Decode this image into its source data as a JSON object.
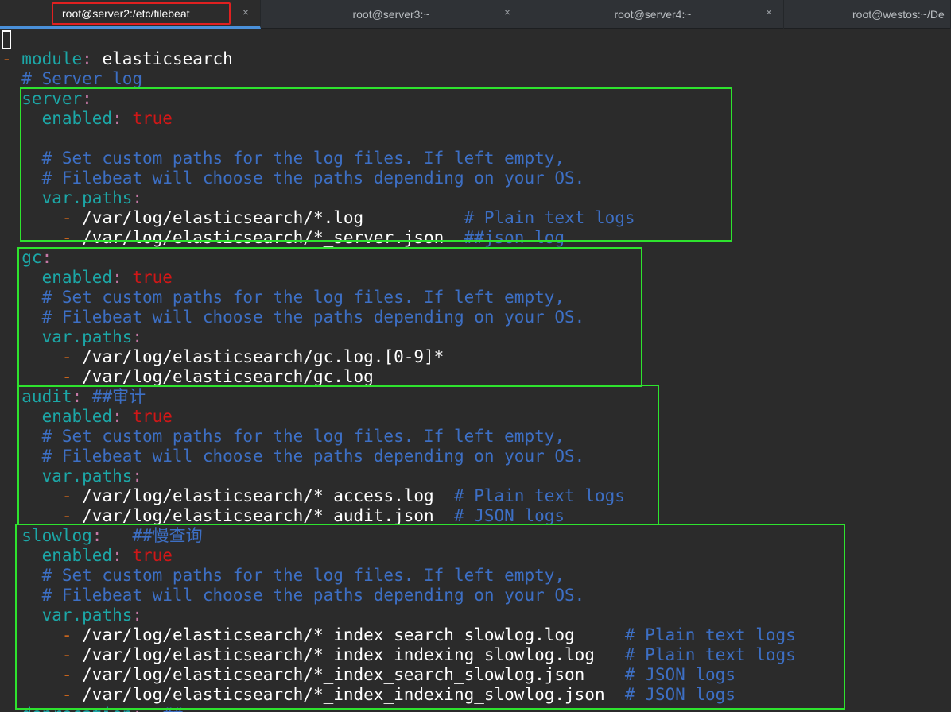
{
  "tabs": [
    {
      "title": "root@server2:/etc/filebeat",
      "active": true
    },
    {
      "title": "root@server3:~",
      "active": false
    },
    {
      "title": "root@server4:~",
      "active": false
    },
    {
      "title": "root@westos:~/De",
      "active": false
    }
  ],
  "close_glyph": "×",
  "colors": {
    "key": "#1ca7a7",
    "comment": "#3d6fc4",
    "bool": "#d11717",
    "dash": "#c7641c",
    "highlight_box": "#2ee32e",
    "tab_highlight": "#e02020"
  },
  "terminal": {
    "lines": [
      [],
      [
        [
          "dash",
          "- "
        ],
        [
          "key",
          "module"
        ],
        [
          "colon",
          ": "
        ],
        [
          "val",
          "elasticsearch"
        ]
      ],
      [
        [
          "comment",
          "  # Server log"
        ]
      ],
      [
        [
          "key",
          "  server"
        ],
        [
          "colon",
          ":"
        ]
      ],
      [
        [
          "key",
          "    enabled"
        ],
        [
          "colon",
          ": "
        ],
        [
          "boolval",
          "true"
        ]
      ],
      [],
      [
        [
          "comment",
          "    # Set custom paths for the log files. If left empty,"
        ]
      ],
      [
        [
          "comment",
          "    # Filebeat will choose the paths depending on your OS."
        ]
      ],
      [
        [
          "key",
          "    var.paths"
        ],
        [
          "colon",
          ":"
        ]
      ],
      [
        [
          "dash",
          "      - "
        ],
        [
          "val",
          "/var/log/elasticsearch/*.log          "
        ],
        [
          "comment",
          "# Plain text logs"
        ]
      ],
      [
        [
          "dash",
          "      - "
        ],
        [
          "val",
          "/var/log/elasticsearch/*_server.json  "
        ],
        [
          "comment",
          "##json log"
        ]
      ],
      [
        [
          "key",
          "  gc"
        ],
        [
          "colon",
          ":"
        ]
      ],
      [
        [
          "key",
          "    enabled"
        ],
        [
          "colon",
          ": "
        ],
        [
          "boolval",
          "true"
        ]
      ],
      [
        [
          "comment",
          "    # Set custom paths for the log files. If left empty,"
        ]
      ],
      [
        [
          "comment",
          "    # Filebeat will choose the paths depending on your OS."
        ]
      ],
      [
        [
          "key",
          "    var.paths"
        ],
        [
          "colon",
          ":"
        ]
      ],
      [
        [
          "dash",
          "      - "
        ],
        [
          "val",
          "/var/log/elasticsearch/gc.log.[0-9]*"
        ]
      ],
      [
        [
          "dash",
          "      - "
        ],
        [
          "val",
          "/var/log/elasticsearch/gc.log"
        ]
      ],
      [
        [
          "key",
          "  audit"
        ],
        [
          "colon",
          ": "
        ],
        [
          "comment",
          "##审计"
        ]
      ],
      [
        [
          "key",
          "    enabled"
        ],
        [
          "colon",
          ": "
        ],
        [
          "boolval",
          "true"
        ]
      ],
      [
        [
          "comment",
          "    # Set custom paths for the log files. If left empty,"
        ]
      ],
      [
        [
          "comment",
          "    # Filebeat will choose the paths depending on your OS."
        ]
      ],
      [
        [
          "key",
          "    var.paths"
        ],
        [
          "colon",
          ":"
        ]
      ],
      [
        [
          "dash",
          "      - "
        ],
        [
          "val",
          "/var/log/elasticsearch/*_access.log  "
        ],
        [
          "comment",
          "# Plain text logs"
        ]
      ],
      [
        [
          "dash",
          "      - "
        ],
        [
          "val",
          "/var/log/elasticsearch/*_audit.json  "
        ],
        [
          "comment",
          "# JSON logs"
        ]
      ],
      [
        [
          "key",
          "  slowlog"
        ],
        [
          "colon",
          ":   "
        ],
        [
          "comment",
          "##慢查询"
        ]
      ],
      [
        [
          "key",
          "    enabled"
        ],
        [
          "colon",
          ": "
        ],
        [
          "boolval",
          "true"
        ]
      ],
      [
        [
          "comment",
          "    # Set custom paths for the log files. If left empty,"
        ]
      ],
      [
        [
          "comment",
          "    # Filebeat will choose the paths depending on your OS."
        ]
      ],
      [
        [
          "key",
          "    var.paths"
        ],
        [
          "colon",
          ":"
        ]
      ],
      [
        [
          "dash",
          "      - "
        ],
        [
          "val",
          "/var/log/elasticsearch/*_index_search_slowlog.log     "
        ],
        [
          "comment",
          "# Plain text logs"
        ]
      ],
      [
        [
          "dash",
          "      - "
        ],
        [
          "val",
          "/var/log/elasticsearch/*_index_indexing_slowlog.log   "
        ],
        [
          "comment",
          "# Plain text logs"
        ]
      ],
      [
        [
          "dash",
          "      - "
        ],
        [
          "val",
          "/var/log/elasticsearch/*_index_search_slowlog.json    "
        ],
        [
          "comment",
          "# JSON logs"
        ]
      ],
      [
        [
          "dash",
          "      - "
        ],
        [
          "val",
          "/var/log/elasticsearch/*_index_indexing_slowlog.json  "
        ],
        [
          "comment",
          "# JSON logs"
        ]
      ],
      [
        [
          "key",
          "  deprecation"
        ],
        [
          "colon",
          ":  "
        ],
        [
          "comment",
          "##"
        ]
      ]
    ]
  }
}
